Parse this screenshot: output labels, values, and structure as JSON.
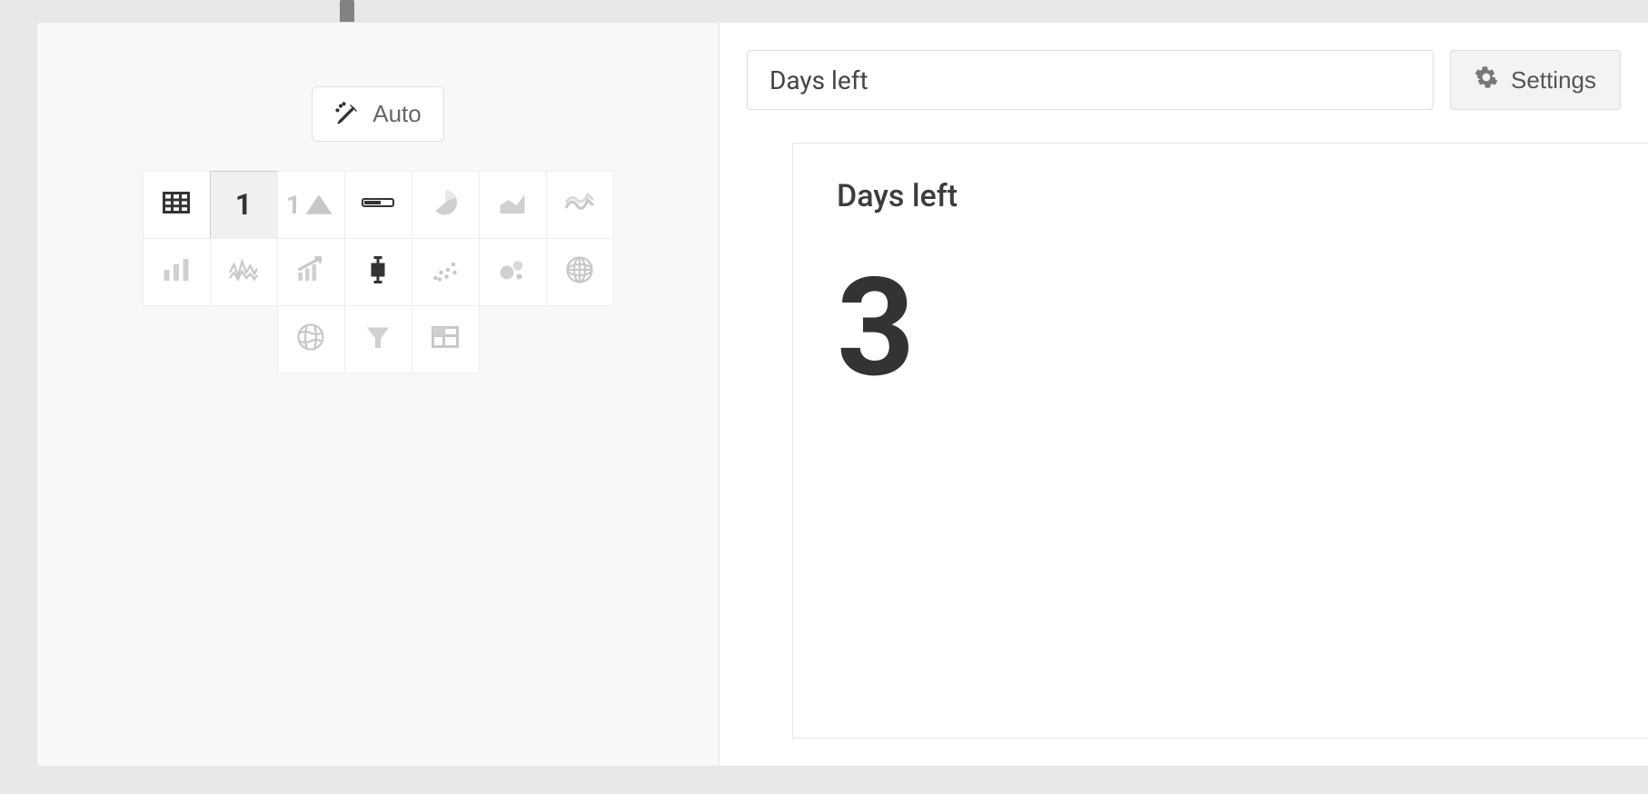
{
  "toolbar": {
    "auto_label": "Auto"
  },
  "viz_options": [
    {
      "name": "table-icon",
      "type": "table"
    },
    {
      "name": "number-icon",
      "type": "number",
      "active": true
    },
    {
      "name": "trend-number-icon",
      "type": "trend"
    },
    {
      "name": "progress-bar-icon",
      "type": "progress"
    },
    {
      "name": "pie-icon",
      "type": "pie"
    },
    {
      "name": "area-icon",
      "type": "area"
    },
    {
      "name": "sparkline-icon",
      "type": "sparkline"
    },
    {
      "name": "bar-icon",
      "type": "bar"
    },
    {
      "name": "multiline-icon",
      "type": "row"
    },
    {
      "name": "trend-line-icon",
      "type": "line"
    },
    {
      "name": "boxplot-icon",
      "type": "combo"
    },
    {
      "name": "scatter-icon",
      "type": "scatter"
    },
    {
      "name": "bubble-icon",
      "type": "bubble"
    },
    {
      "name": "globe-icon",
      "type": "map"
    },
    {
      "name": "globe2-icon",
      "type": "geo"
    },
    {
      "name": "funnel-icon",
      "type": "funnel"
    },
    {
      "name": "pivot-icon",
      "type": "pivot"
    }
  ],
  "header": {
    "title_value": "Days left",
    "settings_label": "Settings"
  },
  "preview": {
    "title": "Days left",
    "value": "3"
  },
  "chart_data": {
    "type": "table",
    "title": "Days left",
    "values": [
      3
    ]
  }
}
